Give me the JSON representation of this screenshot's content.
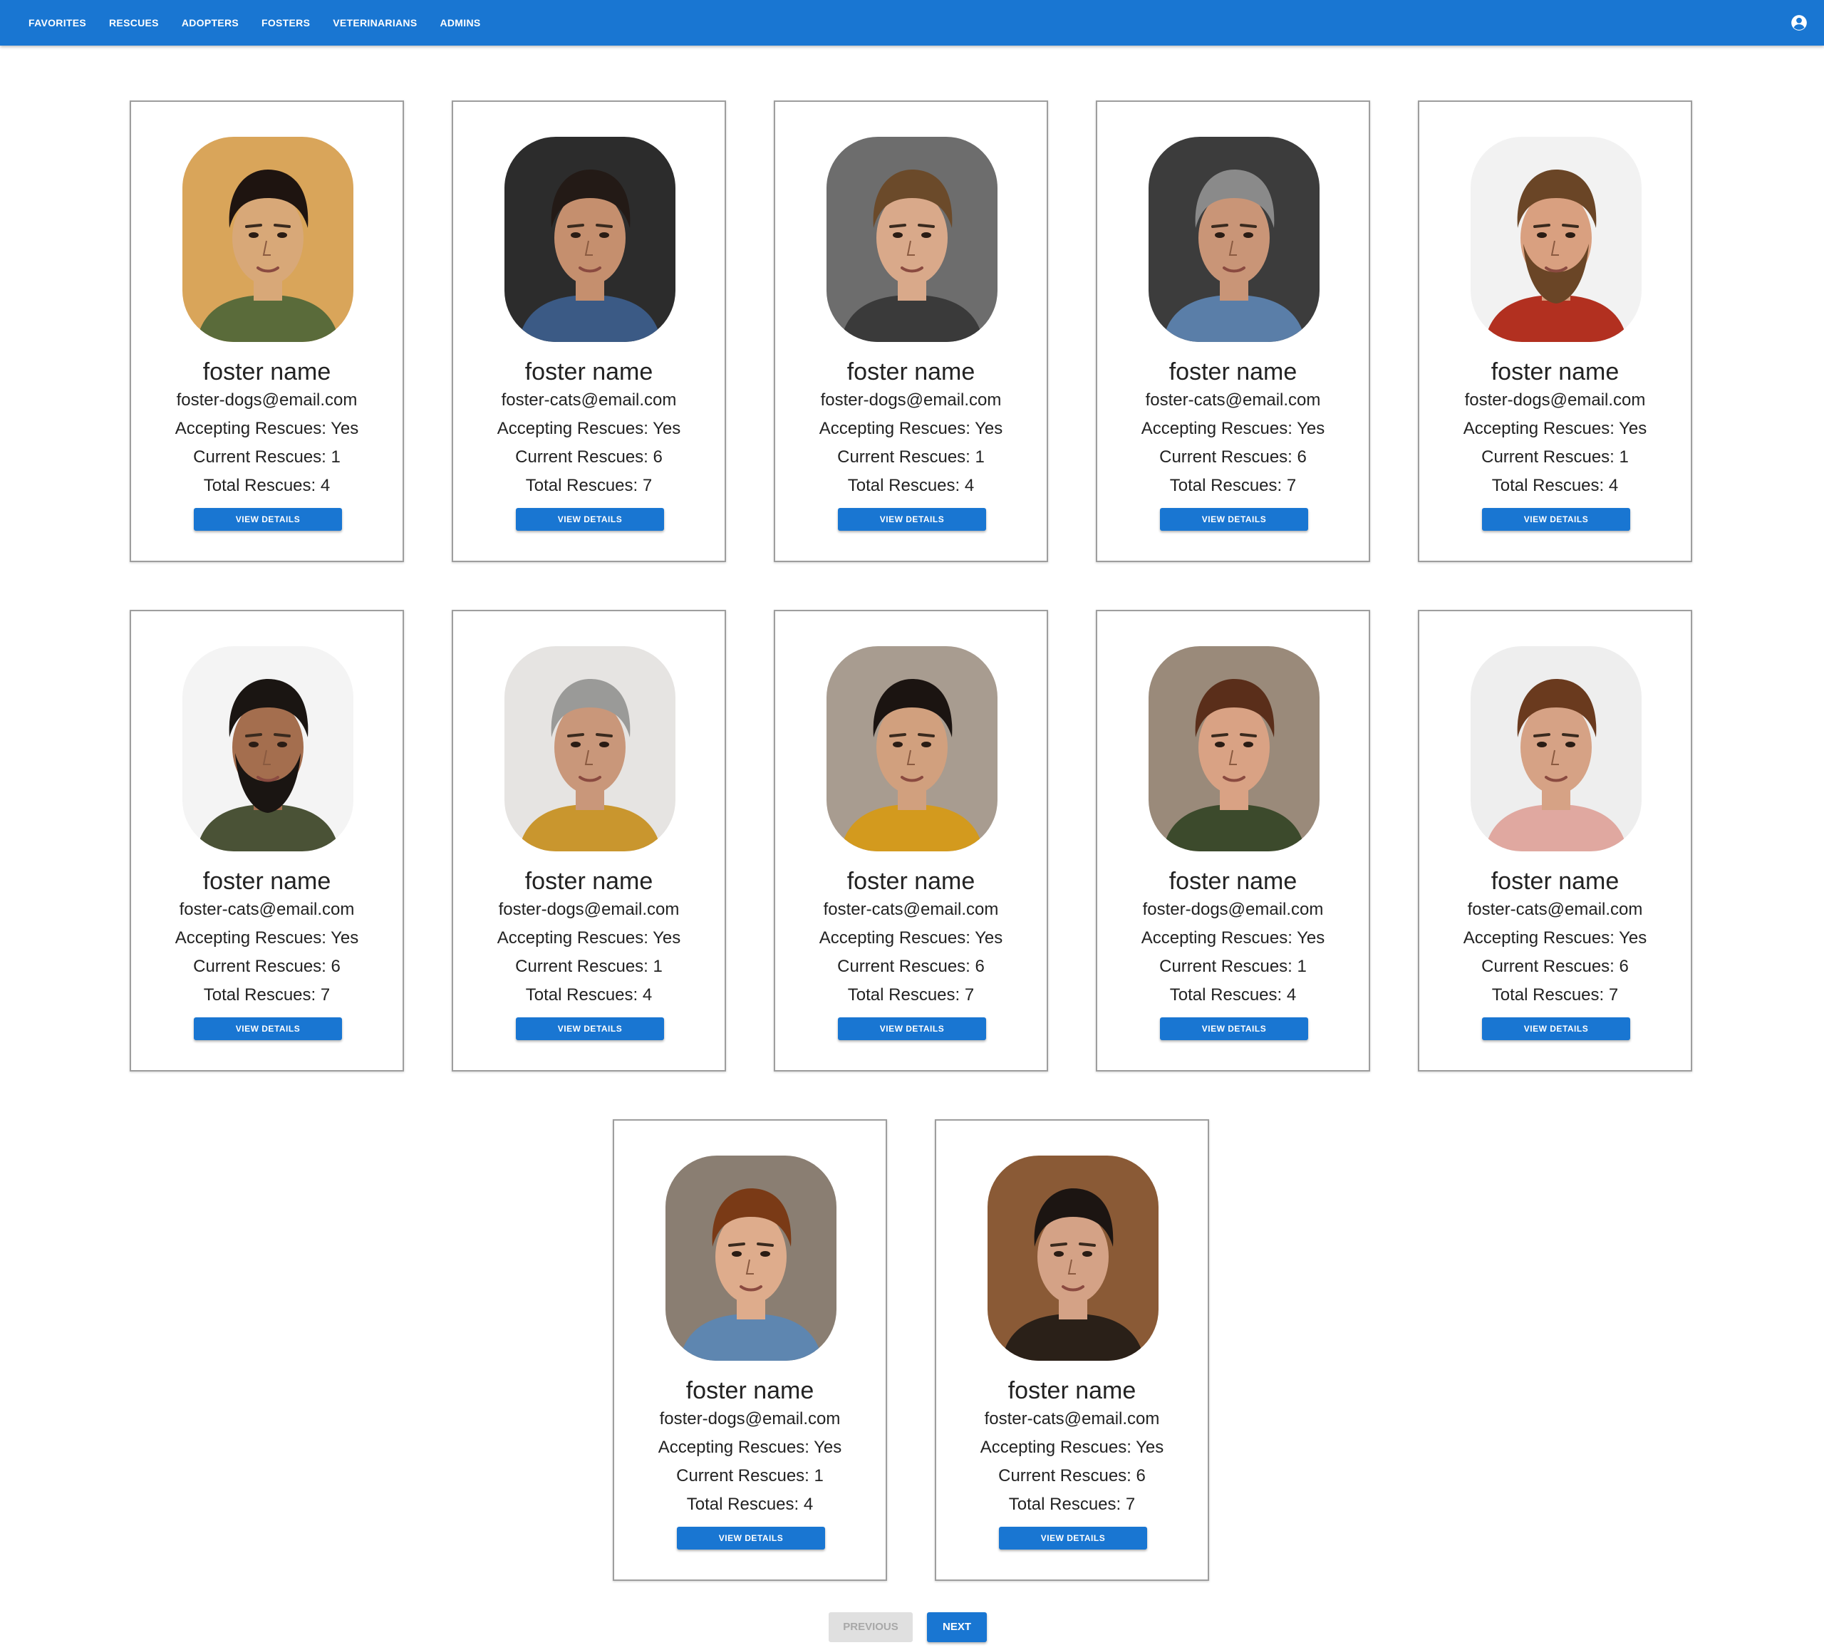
{
  "nav": {
    "items": [
      "FAVORITES",
      "RESCUES",
      "ADOPTERS",
      "FOSTERS",
      "VETERINARIANS",
      "ADMINS"
    ],
    "account_icon": "account-circle-icon"
  },
  "fosters": [
    {
      "name": "foster name",
      "email": "foster-dogs@email.com",
      "accepting": "Accepting Rescues: Yes",
      "current": "Current Rescues: 1",
      "total": "Total Rescues: 4",
      "button": "VIEW DETAILS",
      "skin": "#d8a878",
      "hair": "#1e1410",
      "bg": "#d9a55a",
      "shirt": "#5a6b3a",
      "beard": ""
    },
    {
      "name": "foster name",
      "email": "foster-cats@email.com",
      "accepting": "Accepting Rescues: Yes",
      "current": "Current Rescues: 6",
      "total": "Total Rescues: 7",
      "button": "VIEW DETAILS",
      "skin": "#c58f6e",
      "hair": "#231a16",
      "bg": "#2c2c2c",
      "shirt": "#3b5a85",
      "beard": ""
    },
    {
      "name": "foster name",
      "email": "foster-dogs@email.com",
      "accepting": "Accepting Rescues: Yes",
      "current": "Current Rescues: 1",
      "total": "Total Rescues: 4",
      "button": "VIEW DETAILS",
      "skin": "#d9a98a",
      "hair": "#6b4a2a",
      "bg": "#6d6d6d",
      "shirt": "#3a3a3a",
      "beard": ""
    },
    {
      "name": "foster name",
      "email": "foster-cats@email.com",
      "accepting": "Accepting Rescues: Yes",
      "current": "Current Rescues: 6",
      "total": "Total Rescues: 7",
      "button": "VIEW DETAILS",
      "skin": "#c99577",
      "hair": "#8a8a8a",
      "bg": "#3c3c3c",
      "shirt": "#5a7ea8",
      "beard": ""
    },
    {
      "name": "foster name",
      "email": "foster-dogs@email.com",
      "accepting": "Accepting Rescues: Yes",
      "current": "Current Rescues: 1",
      "total": "Total Rescues: 4",
      "button": "VIEW DETAILS",
      "skin": "#d9a080",
      "hair": "#6a4526",
      "bg": "#f2f2f2",
      "shirt": "#b23020",
      "beard": "#6a4526"
    },
    {
      "name": "foster name",
      "email": "foster-cats@email.com",
      "accepting": "Accepting Rescues: Yes",
      "current": "Current Rescues: 6",
      "total": "Total Rescues: 7",
      "button": "VIEW DETAILS",
      "skin": "#a46e4e",
      "hair": "#1a1512",
      "bg": "#f4f4f4",
      "shirt": "#4a5236",
      "beard": "#1a1512"
    },
    {
      "name": "foster name",
      "email": "foster-dogs@email.com",
      "accepting": "Accepting Rescues: Yes",
      "current": "Current Rescues: 1",
      "total": "Total Rescues: 4",
      "button": "VIEW DETAILS",
      "skin": "#c9977a",
      "hair": "#9a9a98",
      "bg": "#e6e4e2",
      "shirt": "#c9962e",
      "beard": ""
    },
    {
      "name": "foster name",
      "email": "foster-cats@email.com",
      "accepting": "Accepting Rescues: Yes",
      "current": "Current Rescues: 6",
      "total": "Total Rescues: 7",
      "button": "VIEW DETAILS",
      "skin": "#d1a07e",
      "hair": "#1b1411",
      "bg": "#a89c90",
      "shirt": "#d39a1e",
      "beard": ""
    },
    {
      "name": "foster name",
      "email": "foster-dogs@email.com",
      "accepting": "Accepting Rescues: Yes",
      "current": "Current Rescues: 1",
      "total": "Total Rescues: 4",
      "button": "VIEW DETAILS",
      "skin": "#d9a284",
      "hair": "#5a2e1a",
      "bg": "#9a8a7a",
      "shirt": "#3c4a2c",
      "beard": ""
    },
    {
      "name": "foster name",
      "email": "foster-cats@email.com",
      "accepting": "Accepting Rescues: Yes",
      "current": "Current Rescues: 6",
      "total": "Total Rescues: 7",
      "button": "VIEW DETAILS",
      "skin": "#d6a285",
      "hair": "#6a3a1e",
      "bg": "#eeeeee",
      "shirt": "#e0a8a0",
      "beard": ""
    },
    {
      "name": "foster name",
      "email": "foster-dogs@email.com",
      "accepting": "Accepting Rescues: Yes",
      "current": "Current Rescues: 1",
      "total": "Total Rescues: 4",
      "button": "VIEW DETAILS",
      "skin": "#deac8c",
      "hair": "#7a3a16",
      "bg": "#8a7e72",
      "shirt": "#5e86b0",
      "beard": ""
    },
    {
      "name": "foster name",
      "email": "foster-cats@email.com",
      "accepting": "Accepting Rescues: Yes",
      "current": "Current Rescues: 6",
      "total": "Total Rescues: 7",
      "button": "VIEW DETAILS",
      "skin": "#d4a286",
      "hair": "#1c1512",
      "bg": "#8a5a36",
      "shirt": "#2a2018",
      "beard": ""
    }
  ],
  "pagination": {
    "previous": "PREVIOUS",
    "next": "NEXT"
  }
}
